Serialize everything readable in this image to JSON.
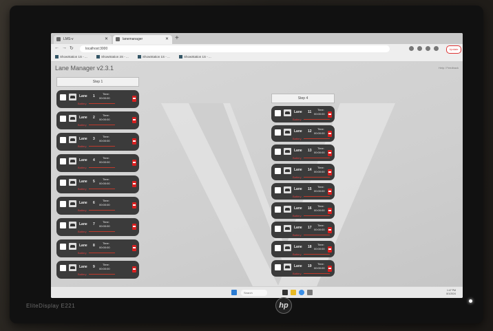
{
  "device": {
    "brand_label": "EliteDisplay E221",
    "logo_text": "hp"
  },
  "browser": {
    "tabs": [
      {
        "label": "LMS-v"
      },
      {
        "label": "lanemanager"
      }
    ],
    "url": "localhost:3000",
    "update_label": "Update",
    "bookmarks": [
      {
        "label": "ShowStation 1S - ..."
      },
      {
        "label": "ShowStation 2S - ..."
      },
      {
        "label": "ShowStation 1S - ..."
      },
      {
        "label": "ShowStation 1S - ..."
      }
    ]
  },
  "app": {
    "title": "Lane Manager v2.3.1",
    "help_link": "Help / Feedback",
    "columns": [
      {
        "step_label": "Step 1",
        "lanes": [
          {
            "label": "Lane",
            "number": "1",
            "time_label": "Time:",
            "time": "00:00:00",
            "battery_label": "Battery"
          },
          {
            "label": "Lane",
            "number": "2",
            "time_label": "Time:",
            "time": "00:00:00",
            "battery_label": "Battery"
          },
          {
            "label": "Lane",
            "number": "3",
            "time_label": "Time:",
            "time": "00:00:00",
            "battery_label": "Battery"
          },
          {
            "label": "Lane",
            "number": "4",
            "time_label": "Time:",
            "time": "00:00:00",
            "battery_label": "Battery"
          },
          {
            "label": "Lane",
            "number": "5",
            "time_label": "Time:",
            "time": "00:00:00",
            "battery_label": "Battery"
          },
          {
            "label": "Lane",
            "number": "6",
            "time_label": "Time:",
            "time": "00:00:00",
            "battery_label": "Battery"
          },
          {
            "label": "Lane",
            "number": "7",
            "time_label": "Time:",
            "time": "00:00:00",
            "battery_label": "Battery"
          },
          {
            "label": "Lane",
            "number": "8",
            "time_label": "Time:",
            "time": "00:00:00",
            "battery_label": "Battery"
          },
          {
            "label": "Lane",
            "number": "9",
            "time_label": "Time:",
            "time": "00:00:00",
            "battery_label": "Battery"
          }
        ]
      },
      {
        "step_label": "Step 4",
        "lanes": [
          {
            "label": "Lane",
            "number": "11",
            "time_label": "Time:",
            "time": "00:00:00",
            "battery_label": "Battery"
          },
          {
            "label": "Lane",
            "number": "12",
            "time_label": "Time:",
            "time": "00:00:00",
            "battery_label": "Battery"
          },
          {
            "label": "Lane",
            "number": "13",
            "time_label": "Time:",
            "time": "00:00:00",
            "battery_label": "Battery"
          },
          {
            "label": "Lane",
            "number": "14",
            "time_label": "Time:",
            "time": "00:00:00",
            "battery_label": "Battery"
          },
          {
            "label": "Lane",
            "number": "15",
            "time_label": "Time:",
            "time": "00:00:00",
            "battery_label": "Battery"
          },
          {
            "label": "Lane",
            "number": "16",
            "time_label": "Time:",
            "time": "00:00:00",
            "battery_label": "Battery"
          },
          {
            "label": "Lane",
            "number": "17",
            "time_label": "Time:",
            "time": "00:00:00",
            "battery_label": "Battery"
          },
          {
            "label": "Lane",
            "number": "18",
            "time_label": "Time:",
            "time": "00:00:00",
            "battery_label": "Battery"
          },
          {
            "label": "Lane",
            "number": "19",
            "time_label": "Time:",
            "time": "00:00:00",
            "battery_label": "Battery"
          }
        ]
      }
    ]
  },
  "taskbar": {
    "search_label": "Search",
    "time": "1:47 PM",
    "date": "8/1/2024"
  },
  "colors": {
    "lane_bg": "#3b3b3b",
    "battery": "#e04040",
    "stop": "#d92020"
  }
}
